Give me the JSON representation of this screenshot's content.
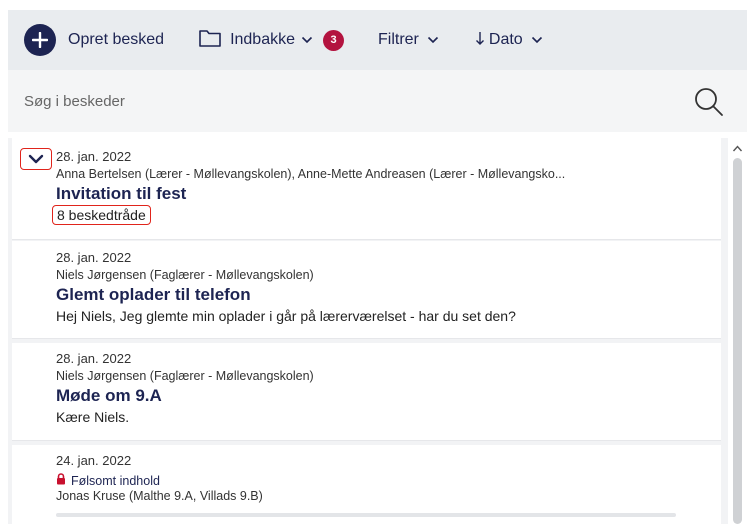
{
  "toolbar": {
    "create_label": "Opret besked",
    "inbox_label": "Indbakke",
    "inbox_badge": "3",
    "filter_label": "Filtrer",
    "date_label": "Dato"
  },
  "search": {
    "placeholder": "Søg i beskeder"
  },
  "messages": [
    {
      "date": "28. jan. 2022",
      "senders": "Anna Bertelsen (Lærer - Møllevangskolen), Anne-Mette Andreasen (Lærer - Møllevangsko...",
      "subject": "Invitation til fest",
      "thread_count": "8 beskedtråde"
    },
    {
      "date": "28. jan. 2022",
      "senders": "Niels Jørgensen (Faglærer - Møllevangskolen)",
      "subject": "Glemt oplader til telefon",
      "preview": "Hej Niels, Jeg glemte min oplader i går på lærerværelset - har du set den?"
    },
    {
      "date": "28. jan. 2022",
      "senders": "Niels Jørgensen (Faglærer - Møllevangskolen)",
      "subject": "Møde om 9.A",
      "preview": "Kære Niels."
    },
    {
      "date": "24. jan. 2022",
      "sensitive_label": "Følsomt indhold",
      "senders": "Jonas Kruse (Malthe 9.A, Villads 9.B)"
    }
  ],
  "colors": {
    "primary": "#1d2452",
    "badge": "#b3133f",
    "highlight": "#e0241b",
    "toolbar_bg": "#e9ecef"
  }
}
